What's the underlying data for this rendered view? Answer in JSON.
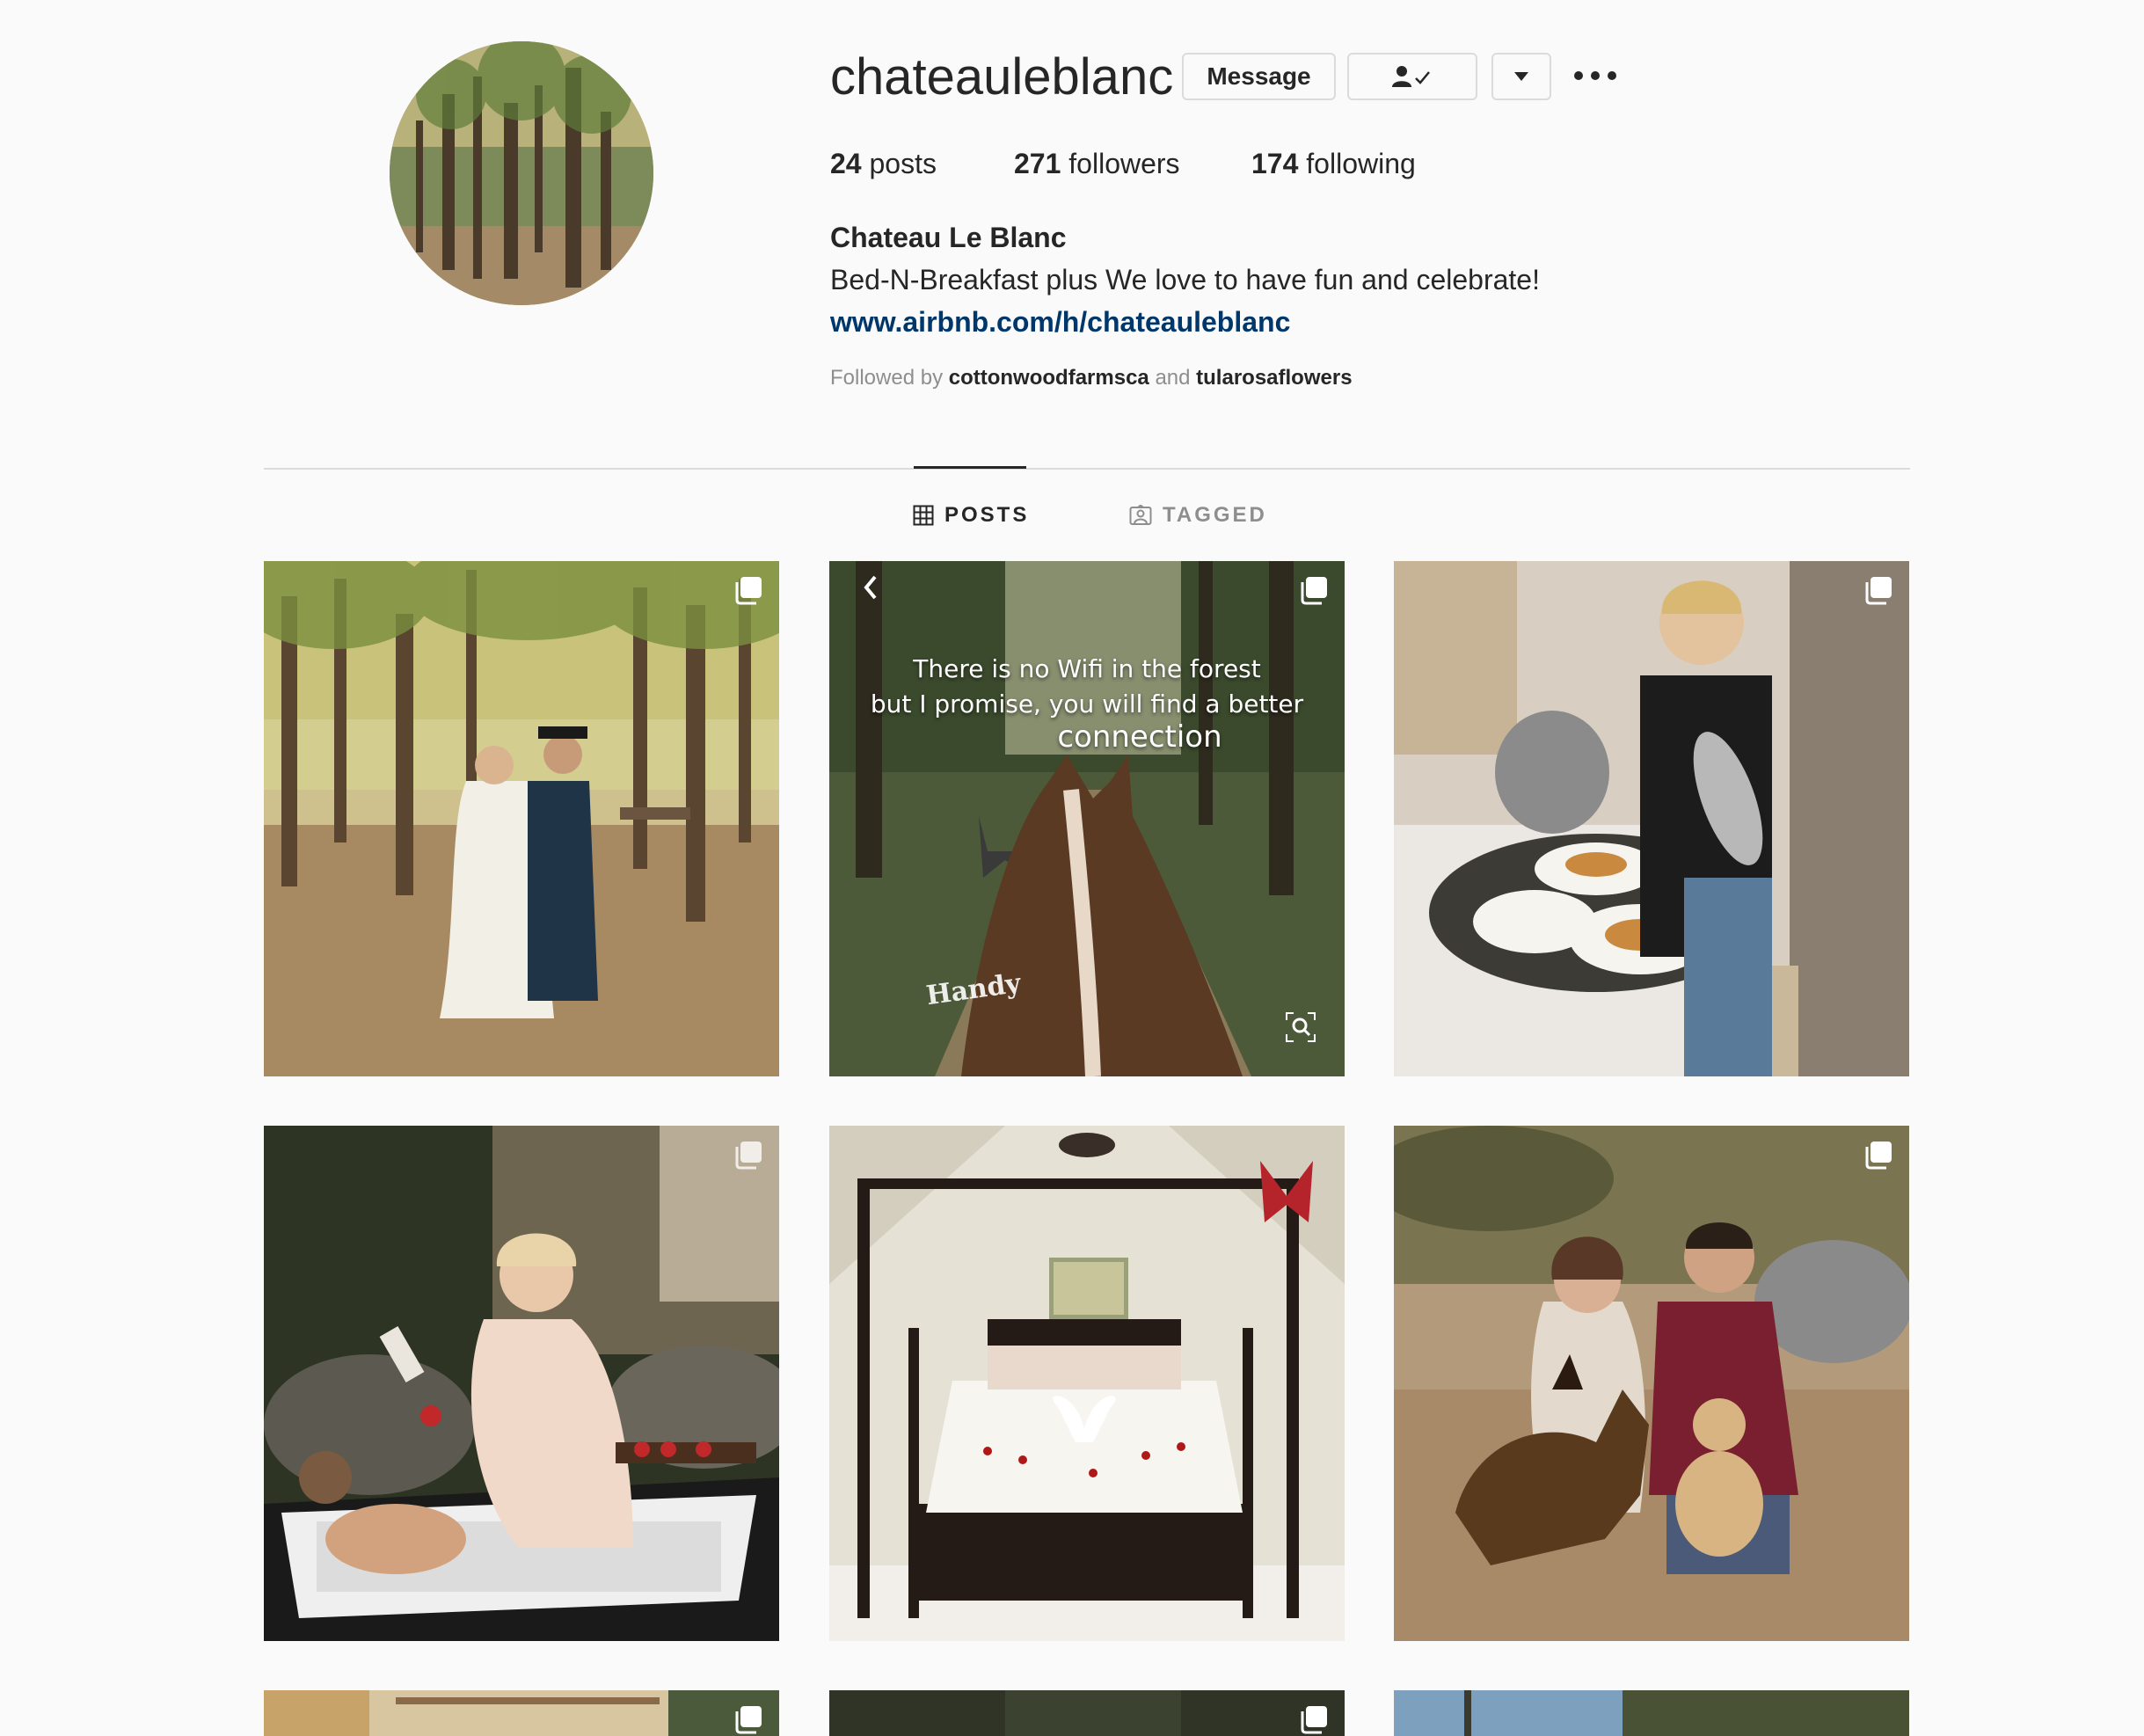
{
  "profile": {
    "username": "chateauleblanc",
    "message_label": "Message",
    "follow_icon": "person-check-icon",
    "dropdown_icon": "caret-down-icon",
    "more_icon": "more-dots-icon",
    "posts_count": "24",
    "posts_label": "posts",
    "followers_count": "271",
    "followers_label": "followers",
    "following_count": "174",
    "following_label": "following",
    "full_name": "Chateau Le Blanc",
    "bio": "Bed-N-Breakfast plus We love to have fun and celebrate!",
    "website": "www.airbnb.com/h/chateauleblanc",
    "followed_by_prefix": "Followed by",
    "followed_by_user1": "cottonwoodfarmsca",
    "followed_by_joiner": "and",
    "followed_by_user2": "tularosaflowers"
  },
  "tabs": {
    "posts_label": "POSTS",
    "tagged_label": "TAGGED",
    "active": "POSTS"
  },
  "posts": {
    "post2_line1": "There is no Wifi in the forest",
    "post2_line2": "but I promise, you will find a better",
    "post2_line3": "connection",
    "post2_watermark": "Handy"
  },
  "colors": {
    "background": "#fafafa",
    "text": "#262626",
    "muted": "#8e8e8e",
    "link": "#00376b",
    "border": "#dbdbdb"
  }
}
